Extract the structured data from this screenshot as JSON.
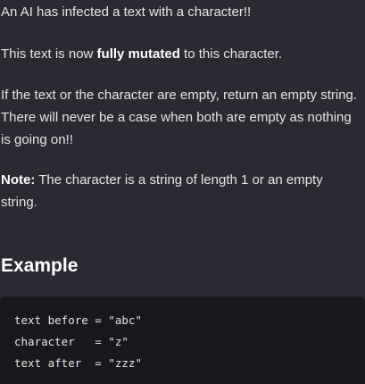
{
  "intro": "An AI has infected a text with a character!!",
  "mutated": {
    "before": "This text is now ",
    "bold": "fully mutated",
    "after": " to this character."
  },
  "empty_rule_line1": "If the text or the character are empty, return an empty string.",
  "empty_rule_line2": "There will never be a case when both are empty as nothing is going on!!",
  "note": {
    "label": "Note:",
    "text": " The character is a string of length 1 or an empty string."
  },
  "example_heading": "Example",
  "code_lines": [
    "text before = \"abc\"",
    "character   = \"z\"",
    "text after  = \"zzz\""
  ]
}
